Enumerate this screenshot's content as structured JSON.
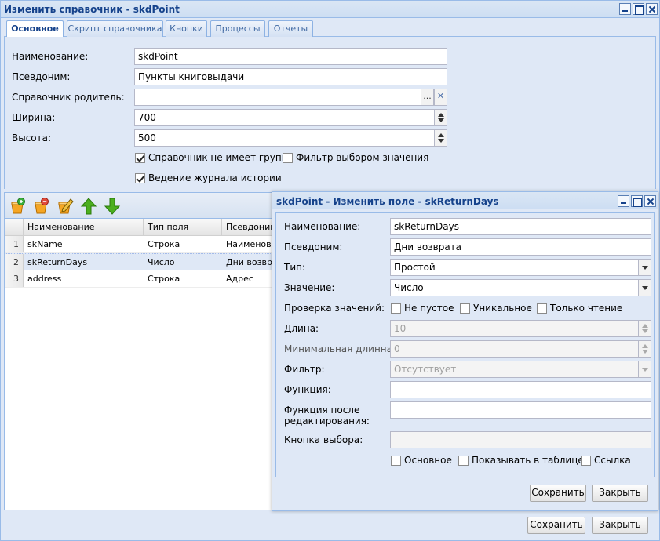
{
  "main_window": {
    "title": "Изменить справочник - skdPoint",
    "tabs": [
      "Основное",
      "Скрипт справочника",
      "Кнопки",
      "Процессы",
      "Отчеты"
    ],
    "active_tab": "Основное",
    "fields": {
      "name_label": "Наименование:",
      "name_value": "skdPoint",
      "alias_label": "Псевдоним:",
      "alias_value": "Пункты книговыдачи",
      "parent_label": "Справочник родитель:",
      "parent_value": "",
      "parent_browse": "...",
      "width_label": "Ширина:",
      "width_value": "700",
      "height_label": "Высота:",
      "height_value": "500"
    },
    "checkboxes": {
      "no_groups": "Справочник не имеет групп",
      "filter_by_value": "Фильтр выбором значения",
      "history_log": "Ведение журнала истории"
    },
    "grid": {
      "columns": [
        "Наименование",
        "Тип поля",
        "Псевдоним"
      ],
      "rows": [
        {
          "num": "1",
          "name": "skName",
          "type": "Строка",
          "alias": "Наименова"
        },
        {
          "num": "2",
          "name": "skReturnDays",
          "type": "Число",
          "alias": "Дни возвра"
        },
        {
          "num": "3",
          "name": "address",
          "type": "Строка",
          "alias": "Адрес"
        }
      ]
    },
    "buttons": {
      "save": "Сохранить",
      "close": "Закрыть"
    }
  },
  "field_dialog": {
    "title": "skdPoint - Изменить поле - skReturnDays",
    "labels": {
      "name": "Наименование:",
      "alias": "Псевдоним:",
      "type": "Тип:",
      "value": "Значение:",
      "validation": "Проверка значений:",
      "length": "Длина:",
      "min_length": "Минимальная длинна:",
      "filter": "Фильтр:",
      "function": "Функция:",
      "function_after_1": "Функция после",
      "function_after_2": "редактирования:",
      "choice_button": "Кнопка выбора:"
    },
    "values": {
      "name": "skReturnDays",
      "alias": "Дни возврата",
      "type": "Простой",
      "value": "Число",
      "length": "10",
      "min_length": "0",
      "filter": "Отсутствует",
      "function": "",
      "function_after": "",
      "choice_button": ""
    },
    "checkboxes": {
      "not_empty": "Не пустое",
      "unique": "Уникальное",
      "read_only": "Только чтение",
      "main": "Основное",
      "show_in_table": "Показывать в таблице",
      "link": "Ссылка"
    },
    "buttons": {
      "save": "Сохранить",
      "close": "Закрыть"
    }
  }
}
